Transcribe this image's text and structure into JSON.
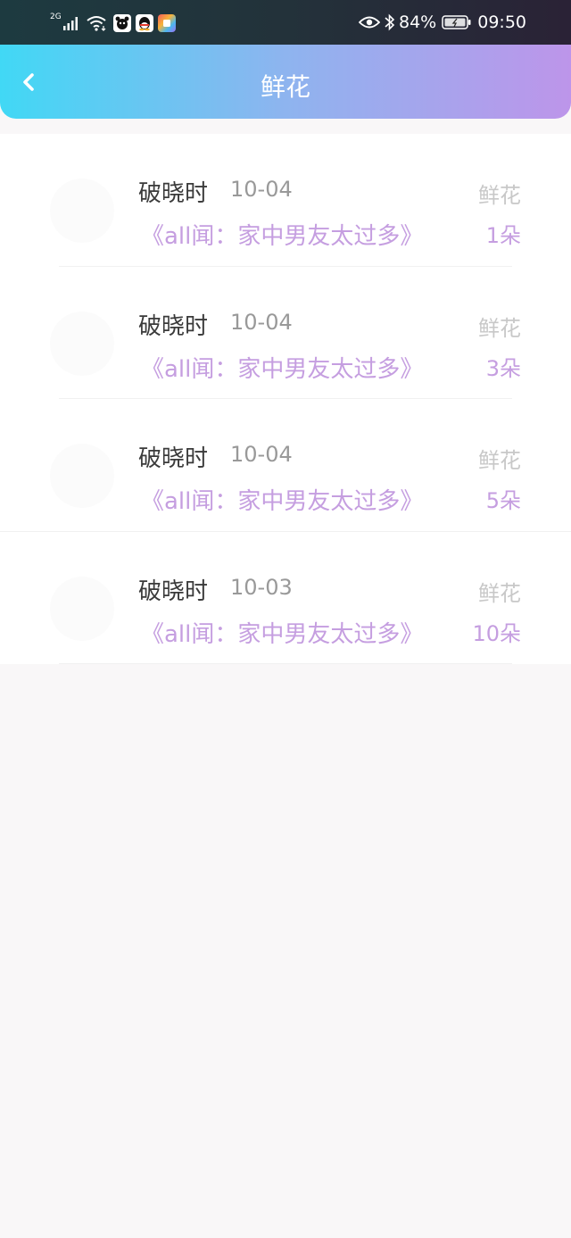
{
  "status_bar": {
    "network": "2G",
    "battery": "84%",
    "time": "09:50"
  },
  "header": {
    "title": "鲜花"
  },
  "records": [
    {
      "name": "破晓时",
      "date": "10-04",
      "label": "鲜花",
      "title": "《all闻：家中男友太过多》",
      "count": "1朵"
    },
    {
      "name": "破晓时",
      "date": "10-04",
      "label": "鲜花",
      "title": "《all闻：家中男友太过多》",
      "count": "3朵"
    },
    {
      "name": "破晓时",
      "date": "10-04",
      "label": "鲜花",
      "title": "《all闻：家中男友太过多》",
      "count": "5朵"
    },
    {
      "name": "破晓时",
      "date": "10-03",
      "label": "鲜花",
      "title": "《all闻：家中男友太过多》",
      "count": "10朵"
    }
  ],
  "icons": {
    "back": "chevron-left-icon",
    "signal": "signal-icon",
    "wifi": "wifi-icon",
    "eye": "eye-icon",
    "bluetooth": "bluetooth-icon",
    "battery": "battery-icon"
  },
  "colors": {
    "header_gradient_start": "#41d8f5",
    "header_gradient_end": "#bd95ea",
    "accent": "#c59ee0",
    "background": "#f9f7f8"
  }
}
